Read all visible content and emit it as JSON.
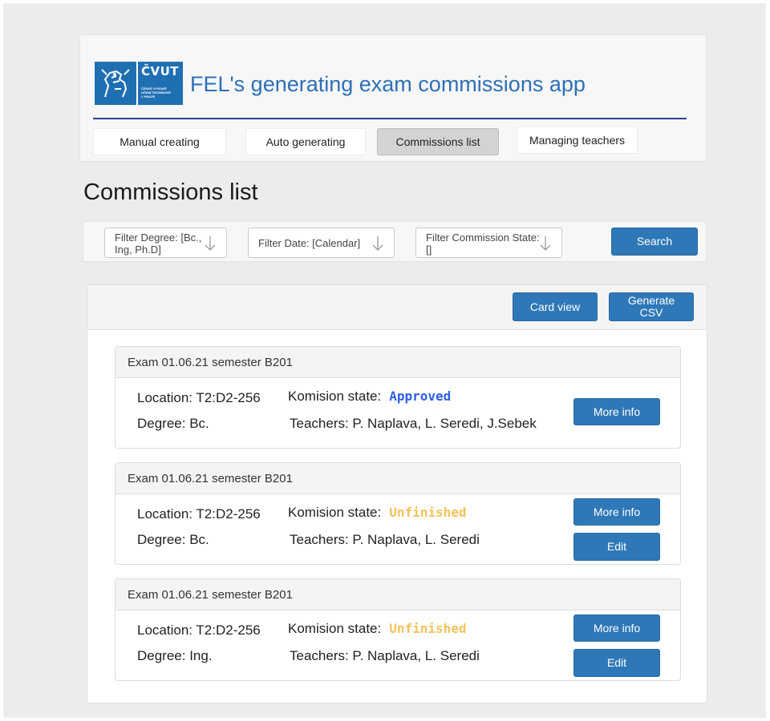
{
  "logo": {
    "name": "ČVUT",
    "sub": [
      "ČESKÉ VYSOKÉ",
      "UČENÍ TECHNICKÉ",
      "V PRAZE"
    ]
  },
  "header": {
    "title": "FEL's generating exam commissions app"
  },
  "tabs": [
    {
      "label": "Manual creating"
    },
    {
      "label": "Auto generating"
    },
    {
      "label": "Commissions list",
      "active": true
    },
    {
      "label": "Managing teachers"
    }
  ],
  "page": {
    "title": "Commissions list"
  },
  "filters": {
    "degree": "Filter Degree: [Bc., Ing, Ph.D]",
    "date": "Filter Date: [Calendar]",
    "state": "Filter Commission State: []",
    "search_label": "Search"
  },
  "toolbar": {
    "card_view": "Card view",
    "generate_csv": "Generate CSV"
  },
  "commissions": [
    {
      "title": "Exam 01.06.21 semester B201",
      "location": "Location: T2:D2-256",
      "state_label": "Komision state:",
      "state": "Approved",
      "degree": "Degree: Bc.",
      "teachers": "Teachers: P. Naplava, L. Seredi, J.Sebek",
      "more_info": "More info"
    },
    {
      "title": "Exam 01.06.21 semester B201",
      "location": "Location: T2:D2-256",
      "state_label": "Komision state:",
      "state": "Unfinished",
      "degree": "Degree: Bc.",
      "teachers": "Teachers: P. Naplava, L. Seredi",
      "more_info": "More info",
      "edit": "Edit"
    },
    {
      "title": "Exam 01.06.21 semester B201",
      "location": "Location: T2:D2-256",
      "state_label": "Komision state:",
      "state": "Unfinished",
      "degree": "Degree: Ing.",
      "teachers": "Teachers: P. Naplava, L. Seredi",
      "more_info": "More info",
      "edit": "Edit"
    }
  ],
  "colors": {
    "accent": "#2f78b8",
    "title_blue": "#2d6fb8",
    "approved": "#2e5de8",
    "unfinished": "#f3c25a"
  }
}
